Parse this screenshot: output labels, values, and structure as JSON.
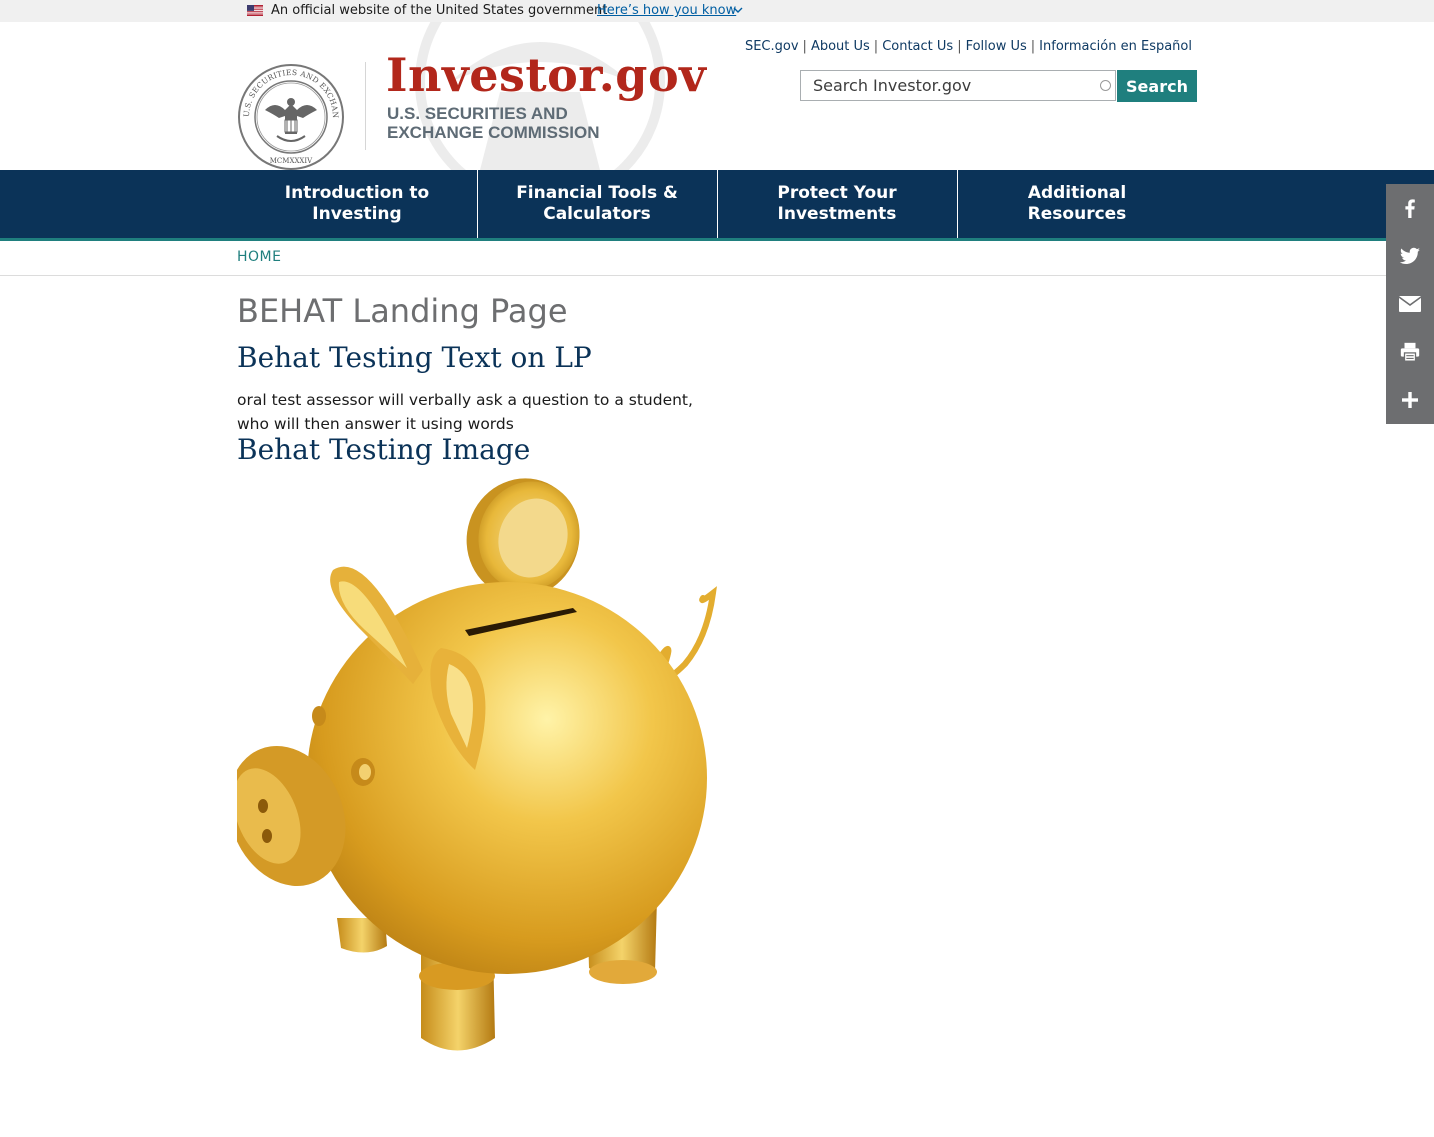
{
  "gov_banner": {
    "official_text": "An official website of the United States government",
    "how_you_know": "Here’s how you know"
  },
  "header": {
    "logo_title": "Investor.gov",
    "logo_sub_line1": "U.S. SECURITIES AND",
    "logo_sub_line2": "EXCHANGE COMMISSION",
    "seal_text": "U.S. SECURITIES AND EXCHANGE COMMISSION MCMXXXIV",
    "utility_links": [
      "SEC.gov",
      "About Us",
      "Contact Us",
      "Follow Us",
      "Información en Español"
    ],
    "search": {
      "placeholder": "Search Investor.gov",
      "button_label": "Search"
    }
  },
  "nav": {
    "items": [
      {
        "line1": "Introduction to",
        "line2": "Investing"
      },
      {
        "line1": "Financial Tools &",
        "line2": "Calculators"
      },
      {
        "line1": "Protect Your",
        "line2": "Investments"
      },
      {
        "line1": "Additional",
        "line2": "Resources"
      }
    ]
  },
  "breadcrumb": {
    "home": "HOME"
  },
  "main": {
    "page_title": "BEHAT Landing Page",
    "section1_heading": "Behat Testing Text on LP",
    "section1_text_line1": "oral test assessor will verbally ask a question to a student,",
    "section1_text_line2": "who will then answer it using words",
    "section2_heading": "Behat Testing Image"
  },
  "share": {
    "icons": [
      "facebook-icon",
      "twitter-icon",
      "email-icon",
      "print-icon",
      "plus-icon"
    ]
  },
  "colors": {
    "navy": "#0b3358",
    "teal": "#1f7f7e",
    "logo_red": "#b2271b",
    "share_gray": "#6d6e70"
  }
}
